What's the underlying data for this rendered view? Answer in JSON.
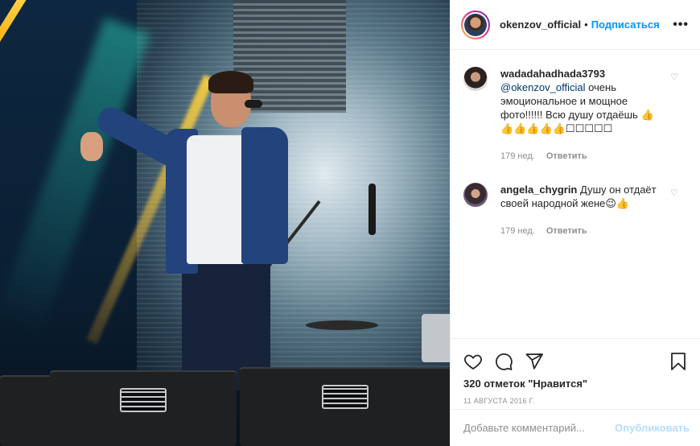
{
  "post": {
    "owner_username": "okenzov_official",
    "separator": "•",
    "follow_label": "Подписаться",
    "more_icon": "more-options-icon",
    "more_label": "•••",
    "likes_text": "320 отметок \"Нравится\"",
    "date_text": "11 августа 2016 г.",
    "add_comment_placeholder": "Добавьте комментарий...",
    "publish_label": "Опубликовать"
  },
  "comments": [
    {
      "username": "wadadahadhada3793",
      "mention": "@okenzov_official",
      "text": " очень эмоциональное и мощное фото!!!!!! Всю душу отдаёшь 👍👍👍👍👍👍☐☐☐☐☐",
      "age": "179 нед.",
      "reply_label": "Ответить",
      "heart_label": "♡"
    },
    {
      "username": "angela_chygrin",
      "mention": "",
      "text": " Душу он отдаёт своей народной жене😉👍",
      "age": "179 нед.",
      "reply_label": "Ответить",
      "heart_label": "♡"
    }
  ],
  "icons": [
    "heart-icon",
    "comment-icon",
    "share-icon",
    "bookmark-icon"
  ],
  "colors": {
    "link_blue": "#0095f6",
    "mention_blue": "#00376b",
    "muted": "#8e8e8e",
    "publish_disabled": "#b2dffc",
    "text": "#262626"
  }
}
